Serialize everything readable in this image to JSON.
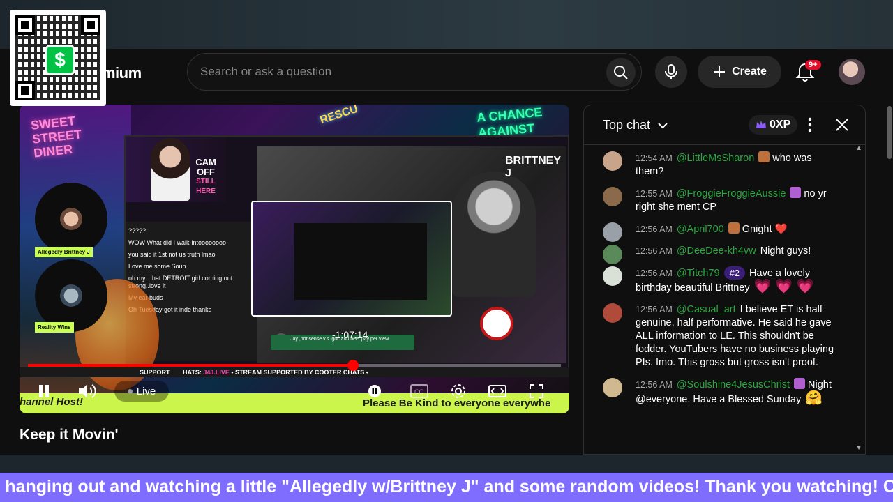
{
  "header": {
    "brand_partial": "mium",
    "search_placeholder": "Search or ask a question",
    "create_label": "Create",
    "notification_badge": "9+"
  },
  "video": {
    "title": "Keep it Movin'",
    "time_display": "-1:07:14",
    "live_label": "Live",
    "progress_fraction": 0.61,
    "overlay": {
      "sign_left": "SWEET STREET DINER",
      "sign_right": "A CHANCE AGAINST",
      "sign_center": "RESCU",
      "host_name": "BRITTNEY J",
      "cam_off": "CAM OFF",
      "cam_off_sub": "STILL HERE",
      "cam_label_1": "Allegedly Brittney J",
      "cam_label_2": "Reality Wins",
      "ticker": "SUPPORT",
      "ticker_mid": "HATS:",
      "ticker_tag": "J4J.LIVE",
      "ticker_rest": "• STREAM SUPPORTED BY COOTER CHATS •",
      "lime_left": "hannel Host!",
      "lime_right": "Please Be Kind to everyone everywhe",
      "bubble_text": "Jay ,nonsense v.s. goc and bee. pay per view",
      "bubble_initial": "S",
      "chat_lines": [
        {
          "user": "",
          "text": "?????"
        },
        {
          "user": "",
          "text": "WOW What did I walk-intoooooooo"
        },
        {
          "user": "",
          "text": "you said it 1st not us truth lmao"
        },
        {
          "user": "",
          "text": "Love me some Soup"
        },
        {
          "user": "",
          "text": "oh my...that DETROIT girl coming out strong..love it"
        },
        {
          "user": "",
          "text": "My ear buds"
        },
        {
          "user": "",
          "text": "Oh Tuesday got it inde thanks"
        }
      ]
    }
  },
  "chat": {
    "title": "Top chat",
    "xp_label": "0XP",
    "messages": [
      {
        "time": "12:54 AM",
        "user": "@LittleMsSharon",
        "text": "who was them?",
        "av": "#c8a58a",
        "emote": "#c0703a",
        "rank": "",
        "extra": ""
      },
      {
        "time": "12:55 AM",
        "user": "@FroggieFroggieAussie",
        "text": "no yr right she ment CP",
        "av": "#8a6a4a",
        "emote": "#b05fd0",
        "rank": "",
        "extra": ""
      },
      {
        "time": "12:56 AM",
        "user": "@April700",
        "text": "Gnight ❤️",
        "av": "#9aa0a8",
        "emote": "#c0703a",
        "rank": "",
        "extra": ""
      },
      {
        "time": "12:56 AM",
        "user": "@DeeDee-kh4vw",
        "text": "Night guys!",
        "av": "#5a8a5a",
        "emote": "",
        "rank": "",
        "extra": ""
      },
      {
        "time": "12:56 AM",
        "user": "@Titch79",
        "text": "Have a lovely birthday beautiful Brittney",
        "av": "#d8e0d8",
        "emote": "",
        "rank": "#2",
        "extra": "💗 💗 💗"
      },
      {
        "time": "12:56 AM",
        "user": "@Casual_art",
        "text": "I believe ET is half genuine, half performative. He said he gave ALL information to LE. This shouldn't be fodder. YouTubers have no business playing PIs. Imo. This gross but gross isn't proof.",
        "av": "#b04a3a",
        "emote": "",
        "rank": "",
        "extra": ""
      },
      {
        "time": "12:56 AM",
        "user": "@Soulshine4JesusChrist",
        "text": "Night @everyone. Have a Blessed Sunday",
        "av": "#d0b890",
        "emote": "#b05fd0",
        "rank": "",
        "extra": "🤗"
      }
    ]
  },
  "marquee": {
    "text": "t hanging out and watching a little \"Allegedly w/Brittney J\" and some random videos! Thank you watching! C"
  },
  "colors": {
    "accent_red": "#ff0000",
    "chat_username": "#2ba640",
    "marquee_bg": "#7f6dff",
    "lime": "#cbf54a",
    "cashapp_green": "#00c244"
  },
  "icons": [
    "search-icon",
    "mic-icon",
    "plus-icon",
    "bell-icon",
    "chevron-down-icon",
    "crown-icon",
    "kebab-icon",
    "close-icon",
    "pause-icon",
    "volume-icon",
    "settings-icon",
    "captions-icon",
    "theater-icon",
    "fullscreen-icon",
    "cashapp-icon"
  ]
}
